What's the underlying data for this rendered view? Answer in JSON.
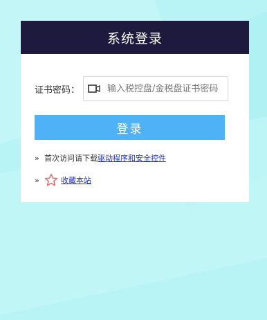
{
  "window": {
    "title": "系统登录"
  },
  "form": {
    "cert_label": "证书密码：",
    "cert_placeholder": "输入税控盘/金税盘证书密码",
    "login_label": "登录"
  },
  "info": {
    "line1_prefix": "首次访问请下载",
    "line1_link": "驱动程序和安全控件",
    "line2_link": "收藏本站"
  },
  "icons": {
    "bullet": "»",
    "cert_icon": "card-reader-icon",
    "favorite_icon": "star-icon"
  },
  "colors": {
    "header": "#1d1a3d",
    "button": "#4fb1f6",
    "link": "#2233bb",
    "star": "#e86a6a",
    "background": "#b8f3f6"
  }
}
